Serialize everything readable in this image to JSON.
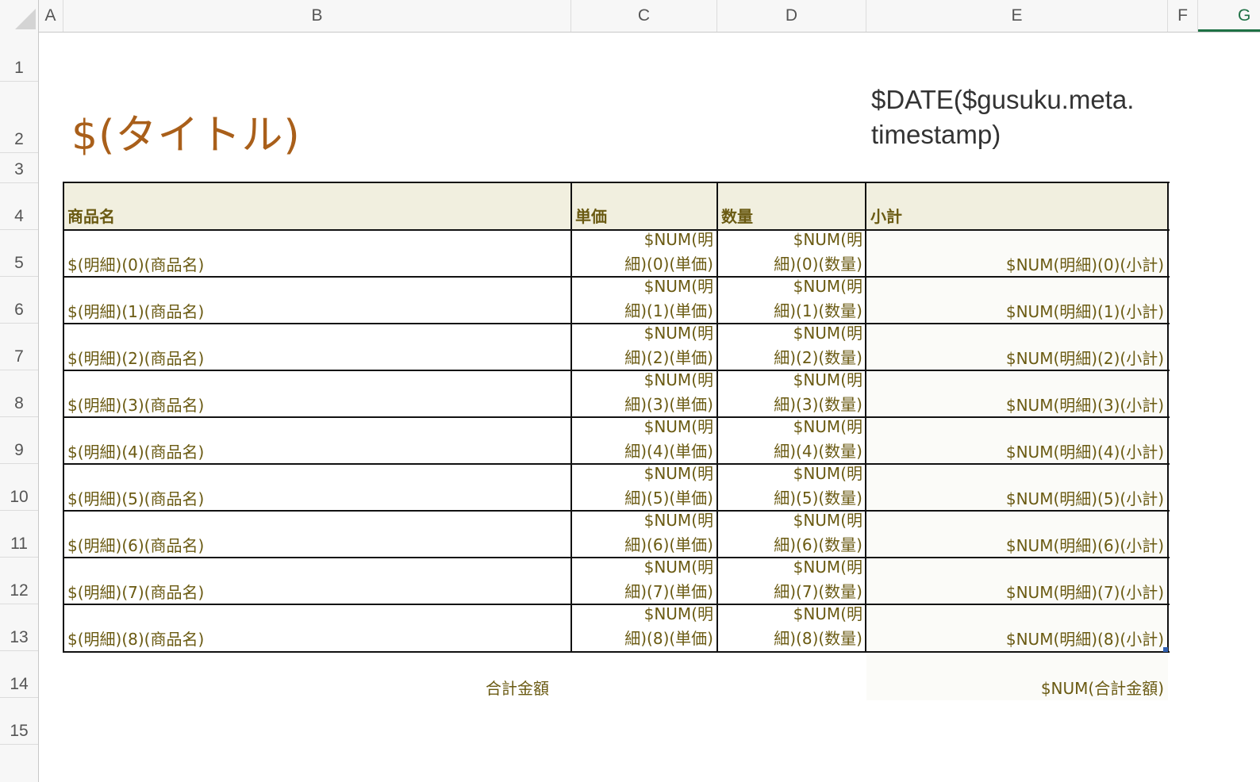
{
  "columns": [
    "A",
    "B",
    "C",
    "D",
    "E",
    "F",
    "G"
  ],
  "rows": [
    "1",
    "2",
    "3",
    "4",
    "5",
    "6",
    "7",
    "8",
    "9",
    "10",
    "11",
    "12",
    "13",
    "14",
    "15"
  ],
  "sheet": {
    "title": "$(タイトル)",
    "date_line1": "$DATE($gusuku.meta.",
    "date_line2": "timestamp)"
  },
  "table": {
    "headers": [
      "商品名",
      "単価",
      "数量",
      "小計"
    ],
    "rows": [
      {
        "name": "$(明細)(0)(商品名)",
        "price_l1": "$NUM(明",
        "price_l2": "細)(0)(単価)",
        "qty_l1": "$NUM(明",
        "qty_l2": "細)(0)(数量)",
        "subtotal": "$NUM(明細)(0)(小計)"
      },
      {
        "name": "$(明細)(1)(商品名)",
        "price_l1": "$NUM(明",
        "price_l2": "細)(1)(単価)",
        "qty_l1": "$NUM(明",
        "qty_l2": "細)(1)(数量)",
        "subtotal": "$NUM(明細)(1)(小計)"
      },
      {
        "name": "$(明細)(2)(商品名)",
        "price_l1": "$NUM(明",
        "price_l2": "細)(2)(単価)",
        "qty_l1": "$NUM(明",
        "qty_l2": "細)(2)(数量)",
        "subtotal": "$NUM(明細)(2)(小計)"
      },
      {
        "name": "$(明細)(3)(商品名)",
        "price_l1": "$NUM(明",
        "price_l2": "細)(3)(単価)",
        "qty_l1": "$NUM(明",
        "qty_l2": "細)(3)(数量)",
        "subtotal": "$NUM(明細)(3)(小計)"
      },
      {
        "name": "$(明細)(4)(商品名)",
        "price_l1": "$NUM(明",
        "price_l2": "細)(4)(単価)",
        "qty_l1": "$NUM(明",
        "qty_l2": "細)(4)(数量)",
        "subtotal": "$NUM(明細)(4)(小計)"
      },
      {
        "name": "$(明細)(5)(商品名)",
        "price_l1": "$NUM(明",
        "price_l2": "細)(5)(単価)",
        "qty_l1": "$NUM(明",
        "qty_l2": "細)(5)(数量)",
        "subtotal": "$NUM(明細)(5)(小計)"
      },
      {
        "name": "$(明細)(6)(商品名)",
        "price_l1": "$NUM(明",
        "price_l2": "細)(6)(単価)",
        "qty_l1": "$NUM(明",
        "qty_l2": "細)(6)(数量)",
        "subtotal": "$NUM(明細)(6)(小計)"
      },
      {
        "name": "$(明細)(7)(商品名)",
        "price_l1": "$NUM(明",
        "price_l2": "細)(7)(単価)",
        "qty_l1": "$NUM(明",
        "qty_l2": "細)(7)(数量)",
        "subtotal": "$NUM(明細)(7)(小計)"
      },
      {
        "name": "$(明細)(8)(商品名)",
        "price_l1": "$NUM(明",
        "price_l2": "細)(8)(単価)",
        "qty_l1": "$NUM(明",
        "qty_l2": "細)(8)(数量)",
        "subtotal": "$NUM(明細)(8)(小計)"
      }
    ]
  },
  "totals": {
    "label": "合計金額",
    "value": "$NUM(合計金額)"
  }
}
